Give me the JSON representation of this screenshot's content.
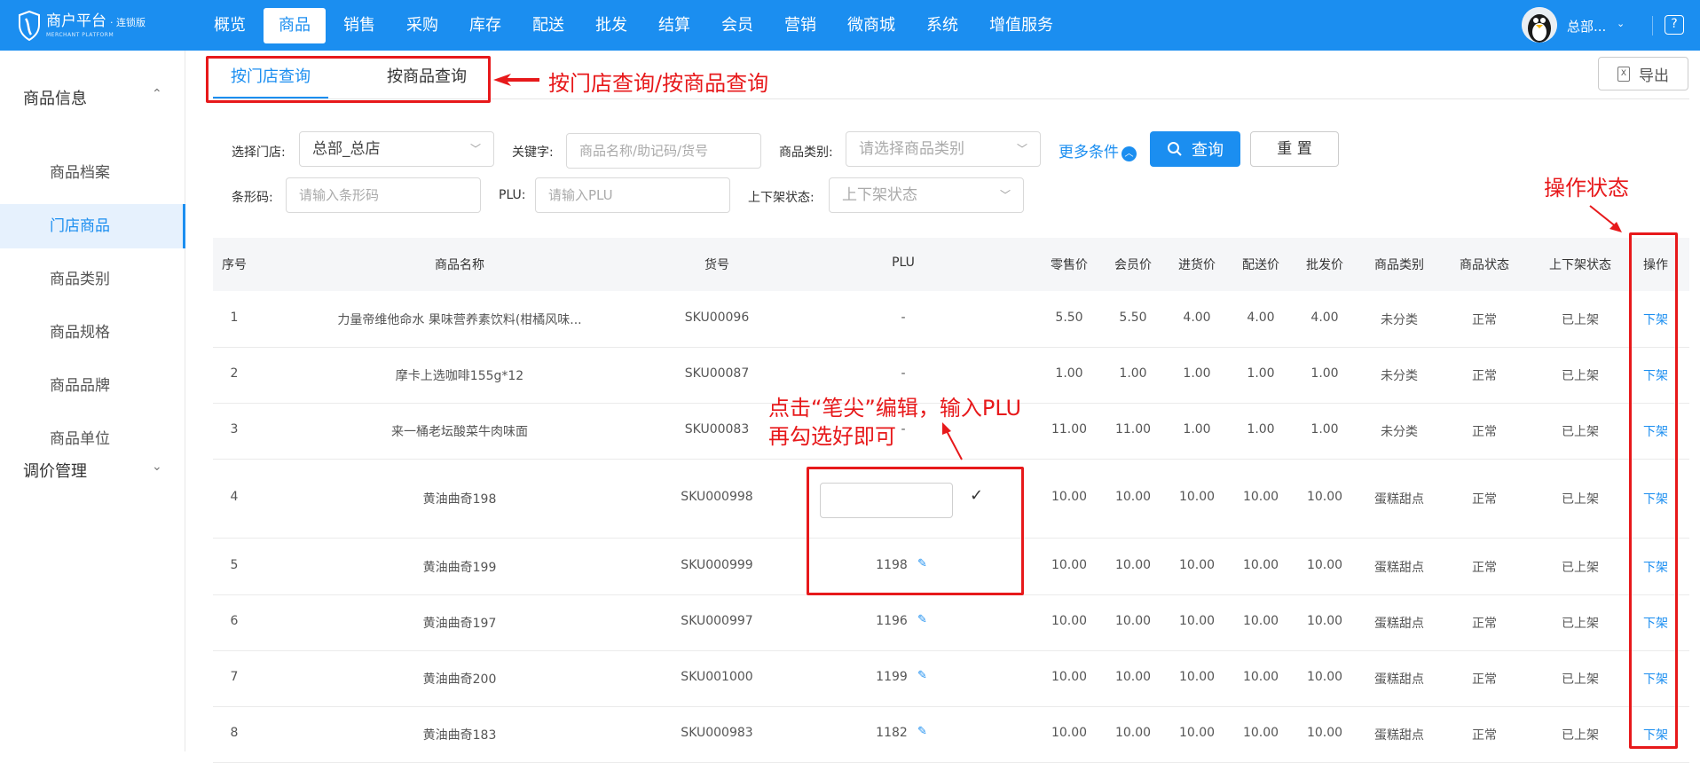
{
  "header": {
    "logo_title": "商户平台",
    "logo_edition": "· 连锁版",
    "logo_sub": "MERCHANT PLATFORM",
    "nav": [
      "概览",
      "商品",
      "销售",
      "采购",
      "库存",
      "配送",
      "批发",
      "结算",
      "会员",
      "营销",
      "微商城",
      "系统",
      "增值服务"
    ],
    "active_nav": "商品",
    "user_name": "总部...",
    "user_caret": "⌄",
    "help": "?"
  },
  "sidebar": {
    "group1": "商品信息",
    "group1_caret": "⌃",
    "items": [
      "商品档案",
      "门店商品",
      "商品类别",
      "商品规格",
      "商品品牌",
      "商品单位"
    ],
    "active_item": "门店商品",
    "group2": "调价管理",
    "group2_caret": "⌄"
  },
  "tabs": [
    "按门店查询",
    "按商品查询"
  ],
  "export_label": "导出",
  "annotations": {
    "tabs_note": "按门店查询/按商品查询",
    "op_note": "操作状态",
    "plu_note_line1": "点击“笔尖”编辑，输入PLU",
    "plu_note_line2": "再勾选好即可"
  },
  "filters": {
    "store_label": "选择门店:",
    "store_value": "总部_总店",
    "keyword_label": "关键字:",
    "keyword_placeholder": "商品名称/助记码/货号",
    "category_label": "商品类别:",
    "category_placeholder": "请选择商品类别",
    "more_label": "更多条件",
    "search_label": "查询",
    "reset_label": "重 置",
    "barcode_label": "条形码:",
    "barcode_placeholder": "请输入条形码",
    "plu_label": "PLU:",
    "plu_placeholder": "请输入PLU",
    "shelf_label": "上下架状态:",
    "shelf_placeholder": "上下架状态"
  },
  "table": {
    "columns": [
      "序号",
      "商品名称",
      "货号",
      "PLU",
      "零售价",
      "会员价",
      "进货价",
      "配送价",
      "批发价",
      "商品类别",
      "商品状态",
      "上下架状态",
      "操作"
    ],
    "rows": [
      [
        "1",
        "力量帝维他命水 果味营养素饮料(柑橘风味...",
        "SKU00096",
        "-",
        "5.50",
        "5.50",
        "4.00",
        "4.00",
        "4.00",
        "未分类",
        "正常",
        "已上架",
        "下架"
      ],
      [
        "2",
        "摩卡上选咖啡155g*12",
        "SKU00087",
        "-",
        "1.00",
        "1.00",
        "1.00",
        "1.00",
        "1.00",
        "未分类",
        "正常",
        "已上架",
        "下架"
      ],
      [
        "3",
        "来一桶老坛酸菜牛肉味面",
        "SKU00083",
        "-",
        "11.00",
        "11.00",
        "1.00",
        "1.00",
        "1.00",
        "未分类",
        "正常",
        "已上架",
        "下架"
      ],
      [
        "4",
        "黄油曲奇198",
        "SKU000998",
        "",
        "10.00",
        "10.00",
        "10.00",
        "10.00",
        "10.00",
        "蛋糕甜点",
        "正常",
        "已上架",
        "下架"
      ],
      [
        "5",
        "黄油曲奇199",
        "SKU000999",
        "1198",
        "10.00",
        "10.00",
        "10.00",
        "10.00",
        "10.00",
        "蛋糕甜点",
        "正常",
        "已上架",
        "下架"
      ],
      [
        "6",
        "黄油曲奇197",
        "SKU000997",
        "1196",
        "10.00",
        "10.00",
        "10.00",
        "10.00",
        "10.00",
        "蛋糕甜点",
        "正常",
        "已上架",
        "下架"
      ],
      [
        "7",
        "黄油曲奇200",
        "SKU001000",
        "1199",
        "10.00",
        "10.00",
        "10.00",
        "10.00",
        "10.00",
        "蛋糕甜点",
        "正常",
        "已上架",
        "下架"
      ],
      [
        "8",
        "黄油曲奇183",
        "SKU000983",
        "1182",
        "10.00",
        "10.00",
        "10.00",
        "10.00",
        "10.00",
        "蛋糕甜点",
        "正常",
        "已上架",
        "下架"
      ]
    ]
  },
  "colors": {
    "primary": "#1b8ef0",
    "annotation": "#e7191b"
  }
}
